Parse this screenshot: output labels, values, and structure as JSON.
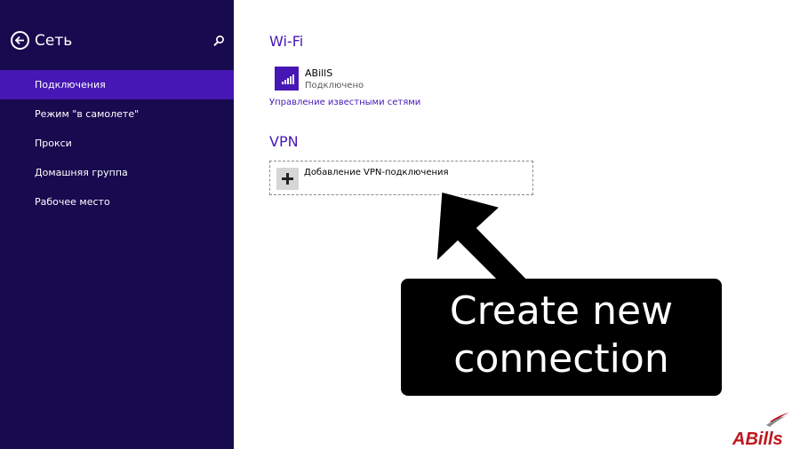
{
  "sidebar": {
    "title": "Сеть",
    "items": [
      {
        "label": "Подключения"
      },
      {
        "label": "Режим \"в самолете\""
      },
      {
        "label": "Прокси"
      },
      {
        "label": "Домашняя группа"
      },
      {
        "label": "Рабочее место"
      }
    ]
  },
  "wifi": {
    "section_title": "Wi-Fi",
    "network_name": "ABillS",
    "network_status": "Подключено",
    "manage_link": "Управление известными сетями"
  },
  "vpn": {
    "section_title": "VPN",
    "add_label": "Добавление VPN-подключения"
  },
  "annotation": {
    "line1": "Create new",
    "line2": "connection"
  },
  "logo": {
    "text": "ABills"
  },
  "colors": {
    "sidebar_bg": "#180a4e",
    "accent": "#4617b4",
    "logo_red": "#c0161d"
  }
}
